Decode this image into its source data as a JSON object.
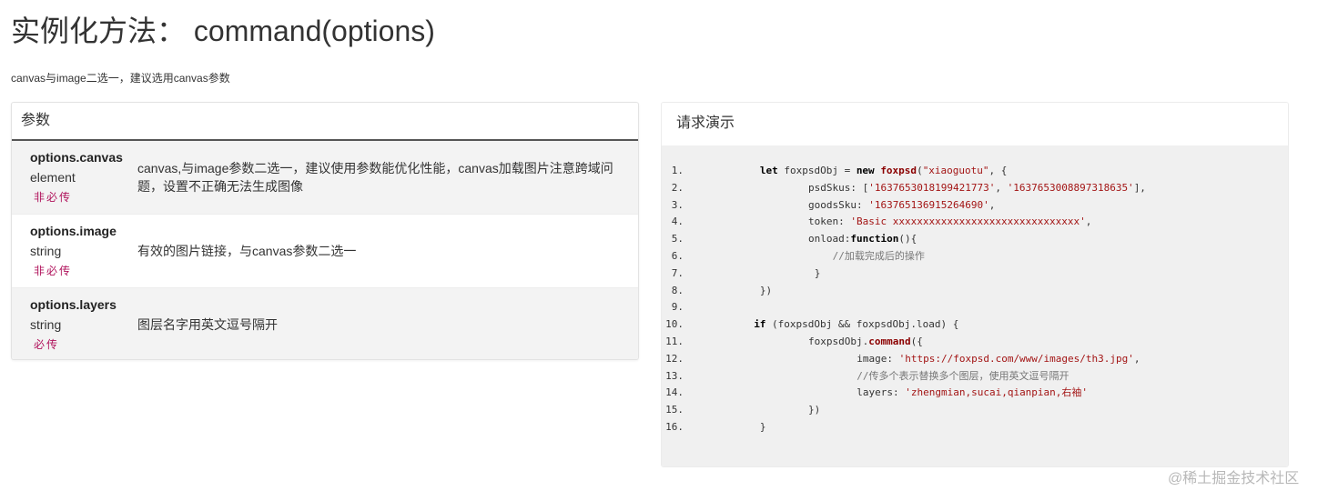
{
  "title": "实例化方法：  command(options)",
  "subtitle": "canvas与image二选一，建议选用canvas参数",
  "params": {
    "header": "参数",
    "rows": [
      {
        "name": "options.canvas",
        "type": "element",
        "required": "非必传",
        "desc": "canvas,与image参数二选一，建议使用参数能优化性能，canvas加载图片注意跨域问题，设置不正确无法生成图像"
      },
      {
        "name": "options.image",
        "type": "string",
        "required": "非必传",
        "desc": "有效的图片链接，与canvas参数二选一"
      },
      {
        "name": "options.layers",
        "type": "string",
        "required": "必传",
        "desc": "图层名字用英文逗号隔开"
      }
    ]
  },
  "demo": {
    "header": "请求演示",
    "lang": "js",
    "lines": [
      {
        "n": "1.",
        "indent": 9,
        "parts": [
          {
            "t": "let",
            "c": "kw"
          },
          {
            "t": " foxpsdObj = "
          },
          {
            "t": "new",
            "c": "kw"
          },
          {
            "t": " "
          },
          {
            "t": "foxpsd",
            "c": "fn"
          },
          {
            "t": "("
          },
          {
            "t": "\"xiaoguotu\"",
            "c": "str"
          },
          {
            "t": ", {"
          }
        ]
      },
      {
        "n": "2.",
        "indent": 17,
        "parts": [
          {
            "t": "psdSkus: ["
          },
          {
            "t": "'1637653018199421773'",
            "c": "str"
          },
          {
            "t": ", "
          },
          {
            "t": "'1637653008897318635'",
            "c": "str"
          },
          {
            "t": "],"
          }
        ]
      },
      {
        "n": "3.",
        "indent": 17,
        "parts": [
          {
            "t": "goodsSku: "
          },
          {
            "t": "'163765136915264690'",
            "c": "str"
          },
          {
            "t": ","
          }
        ]
      },
      {
        "n": "4.",
        "indent": 17,
        "parts": [
          {
            "t": "token: "
          },
          {
            "t": "'Basic xxxxxxxxxxxxxxxxxxxxxxxxxxxxxxx'",
            "c": "str"
          },
          {
            "t": ","
          }
        ]
      },
      {
        "n": "5.",
        "indent": 17,
        "parts": [
          {
            "t": "onload:"
          },
          {
            "t": "function",
            "c": "kw"
          },
          {
            "t": "(){"
          }
        ]
      },
      {
        "n": "6.",
        "indent": 21,
        "parts": [
          {
            "t": "//加载完成后的操作",
            "c": "cm"
          }
        ]
      },
      {
        "n": "7.",
        "indent": 18,
        "parts": [
          {
            "t": "}"
          }
        ]
      },
      {
        "n": "8.",
        "indent": 9,
        "parts": [
          {
            "t": "})"
          }
        ]
      },
      {
        "n": "9.",
        "indent": 0,
        "parts": []
      },
      {
        "n": "10.",
        "indent": 8,
        "parts": [
          {
            "t": "if",
            "c": "kw"
          },
          {
            "t": " (foxpsdObj && foxpsdObj.load) {"
          }
        ]
      },
      {
        "n": "11.",
        "indent": 17,
        "parts": [
          {
            "t": "foxpsdObj."
          },
          {
            "t": "command",
            "c": "fn"
          },
          {
            "t": "({"
          }
        ]
      },
      {
        "n": "12.",
        "indent": 25,
        "parts": [
          {
            "t": "image: "
          },
          {
            "t": "'https://foxpsd.com/www/images/th3.jpg'",
            "c": "str"
          },
          {
            "t": ","
          }
        ]
      },
      {
        "n": "13.",
        "indent": 25,
        "parts": [
          {
            "t": "//传多个表示替换多个图层，使用英文逗号隔开",
            "c": "cm"
          }
        ]
      },
      {
        "n": "14.",
        "indent": 25,
        "parts": [
          {
            "t": "layers: "
          },
          {
            "t": "'zhengmian,sucai,qianpian,右袖'",
            "c": "str"
          }
        ]
      },
      {
        "n": "15.",
        "indent": 17,
        "parts": [
          {
            "t": "})"
          }
        ]
      },
      {
        "n": "16.",
        "indent": 9,
        "parts": [
          {
            "t": "}"
          }
        ]
      }
    ]
  },
  "watermark": "@稀土掘金技术社区"
}
